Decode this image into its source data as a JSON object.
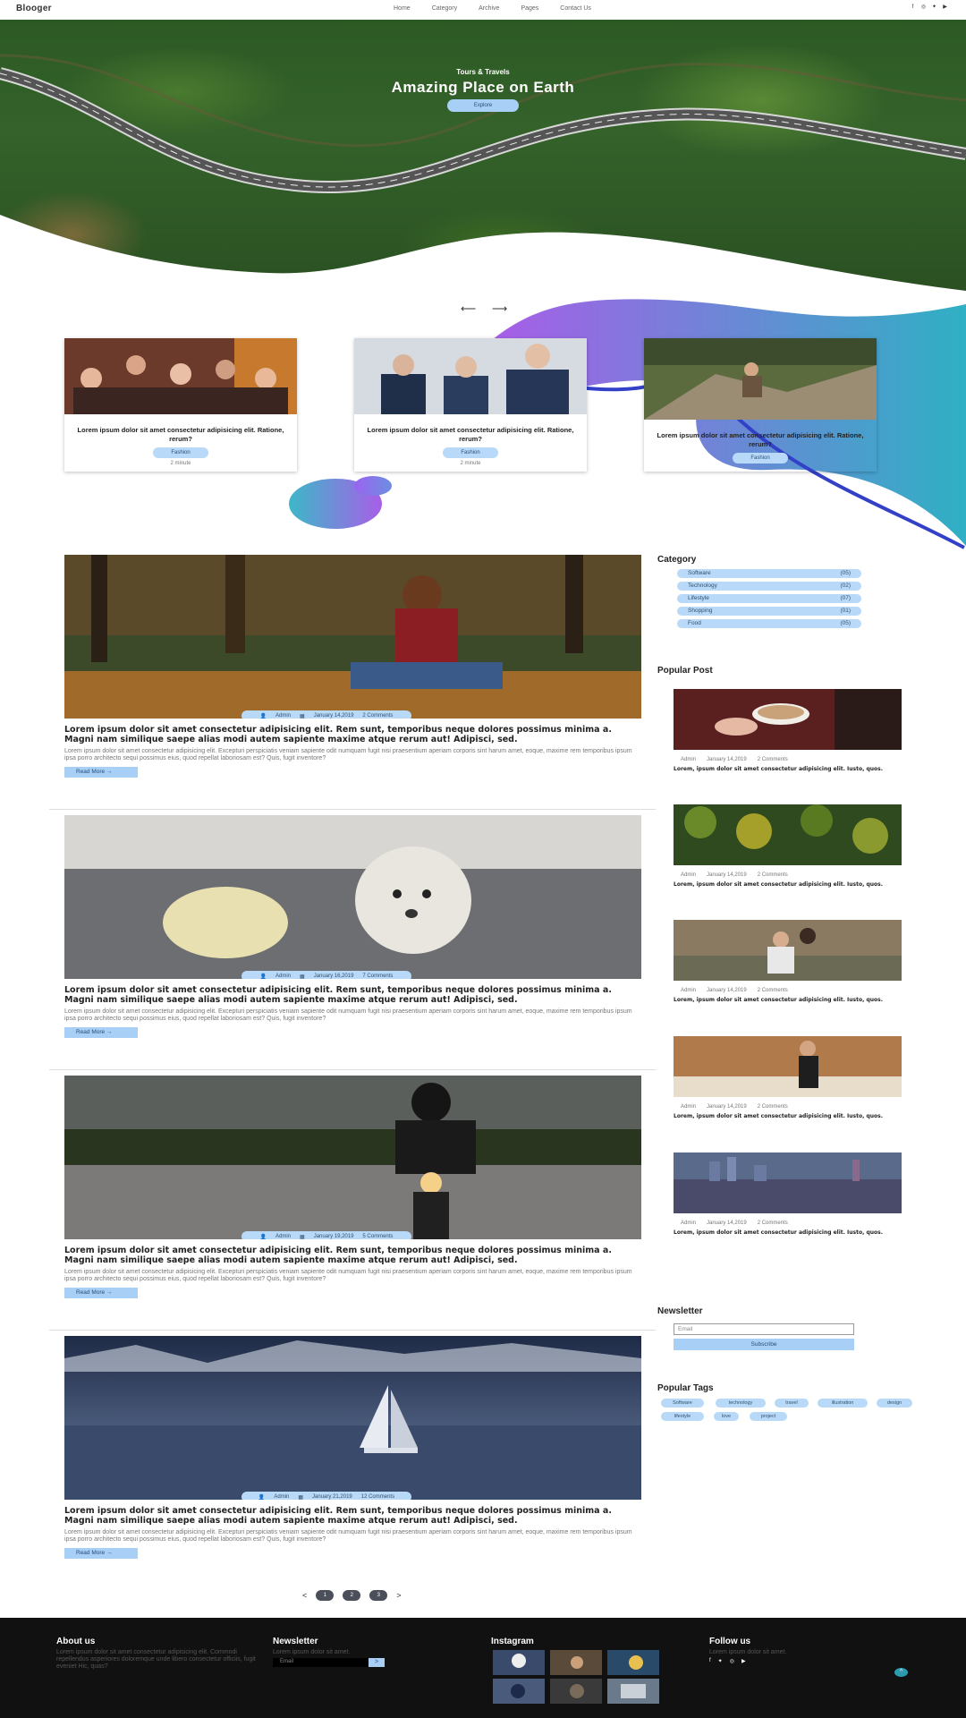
{
  "nav": {
    "brand": "Blooger",
    "menu": [
      "Home",
      "Category",
      "Archive",
      "Pages",
      "Contact Us"
    ],
    "social_icons": [
      "facebook-icon",
      "instagram-icon",
      "twitter-icon",
      "youtube-icon"
    ]
  },
  "hero": {
    "subtitle": "Tours & Travels",
    "title": "Amazing Place on Earth",
    "button": "Explore"
  },
  "carousel": {
    "prev_icon": "arrow-left-icon",
    "next_icon": "arrow-right-icon"
  },
  "featured": [
    {
      "title": "Lorem ipsum dolor sit amet consectetur adipisicing elit. Ratione, rerum?",
      "tag": "Fashion",
      "meta": "2 minute"
    },
    {
      "title": "Lorem ipsum dolor sit amet consectetur adipisicing elit. Ratione, rerum?",
      "tag": "Fashion",
      "meta": "2 minute"
    },
    {
      "title": "Lorem ipsum dolor sit amet consectetur adipisicing elit. Ratione, rerum?",
      "tag": "Fashion",
      "meta": ""
    }
  ],
  "posts": [
    {
      "author": "Admin",
      "date": "January 14,2019",
      "comments": "2 Comments",
      "title": "Lorem ipsum dolor sit amet consectetur adipisicing elit. Rem sunt, temporibus neque dolores possimus minima a. Magni nam similique saepe alias modi autem sapiente maxime atque rerum aut! Adipisci, sed.",
      "excerpt": "Lorem ipsum dolor sit amet consectetur adipisicing elit. Excepturi perspiciatis veniam sapiente odit numquam fugit nisi praesentium aperiam corporis sint harum amet, eoque, maxime rem temporibus ipsum ipsa porro architecto sequi possimus eius, quod repellat laboriosam est? Quis, fugit inventore?",
      "read_more": "Read More"
    },
    {
      "author": "Admin",
      "date": "January 16,2019",
      "comments": "7 Comments",
      "title": "Lorem ipsum dolor sit amet consectetur adipisicing elit. Rem sunt, temporibus neque dolores possimus minima a. Magni nam similique saepe alias modi autem sapiente maxime atque rerum aut! Adipisci, sed.",
      "excerpt": "Lorem ipsum dolor sit amet consectetur adipisicing elit. Excepturi perspiciatis veniam sapiente odit numquam fugit nisi praesentium aperiam corporis sint harum amet, eoque, maxime rem temporibus ipsum ipsa porro architecto sequi possimus eius, quod repellat laboriosam est? Quis, fugit inventore?",
      "read_more": "Read More"
    },
    {
      "author": "Admin",
      "date": "January 19,2019",
      "comments": "5 Comments",
      "title": "Lorem ipsum dolor sit amet consectetur adipisicing elit. Rem sunt, temporibus neque dolores possimus minima a. Magni nam similique saepe alias modi autem sapiente maxime atque rerum aut! Adipisci, sed.",
      "excerpt": "Lorem ipsum dolor sit amet consectetur adipisicing elit. Excepturi perspiciatis veniam sapiente odit numquam fugit nisi praesentium aperiam corporis sint harum amet, eoque, maxime rem temporibus ipsum ipsa porro architecto sequi possimus eius, quod repellat laboriosam est? Quis, fugit inventore?",
      "read_more": "Read More"
    },
    {
      "author": "Admin",
      "date": "January 21,2019",
      "comments": "12 Comments",
      "title": "Lorem ipsum dolor sit amet consectetur adipisicing elit. Rem sunt, temporibus neque dolores possimus minima a. Magni nam similique saepe alias modi autem sapiente maxime atque rerum aut! Adipisci, sed.",
      "excerpt": "Lorem ipsum dolor sit amet consectetur adipisicing elit. Excepturi perspiciatis veniam sapiente odit numquam fugit nisi praesentium aperiam corporis sint harum amet, eoque, maxime rem temporibus ipsum ipsa porro architecto sequi possimus eius, quod repellat laboriosam est? Quis, fugit inventore?",
      "read_more": "Read More"
    }
  ],
  "pagination": {
    "prev": "<",
    "pages": [
      "1",
      "2",
      "3"
    ],
    "next": ">"
  },
  "sidebar": {
    "category_title": "Category",
    "categories": [
      {
        "name": "Software",
        "count": "(05)"
      },
      {
        "name": "Technology",
        "count": "(02)"
      },
      {
        "name": "Lifestyle",
        "count": "(07)"
      },
      {
        "name": "Shopping",
        "count": "(01)"
      },
      {
        "name": "Food",
        "count": "(05)"
      }
    ],
    "popular_title": "Popular Post",
    "popular": [
      {
        "author": "Admin",
        "date": "January 14,2019",
        "comments": "2 Comments",
        "title": "Lorem, ipsum dolor sit amet consectetur adipisicing elit. Iusto, quos."
      },
      {
        "author": "Admin",
        "date": "January 14,2019",
        "comments": "2 Comments",
        "title": "Lorem, ipsum dolor sit amet consectetur adipisicing elit. Iusto, quos."
      },
      {
        "author": "Admin",
        "date": "January 14,2019",
        "comments": "2 Comments",
        "title": "Lorem, ipsum dolor sit amet consectetur adipisicing elit. Iusto, quos."
      },
      {
        "author": "Admin",
        "date": "January 14,2019",
        "comments": "2 Comments",
        "title": "Lorem, ipsum dolor sit amet consectetur adipisicing elit. Iusto, quos."
      },
      {
        "author": "Admin",
        "date": "January 14,2019",
        "comments": "2 Comments",
        "title": "Lorem, ipsum dolor sit amet consectetur adipisicing elit. Iusto, quos."
      }
    ],
    "newsletter_title": "Newsletter",
    "newsletter_placeholder": "Email",
    "newsletter_button": "Subscribe",
    "tags_title": "Popular Tags",
    "tags": [
      "Software",
      "technology",
      "travel",
      "illustration",
      "design",
      "lifestyle",
      "love",
      "project"
    ]
  },
  "footer": {
    "about_title": "About us",
    "about_text": "Lorem ipsum dolor sit amet consectetur adipisicing elit. Commodi repellendus asperiores doloremque unde libero consectetur officiis, fugit eveniet Hic, quas?",
    "newsletter_title": "Newsletter",
    "newsletter_text": "Lorem ipsum dolor sit amet.",
    "newsletter_placeholder": "Email",
    "newsletter_button": ">",
    "instagram_title": "Instagram",
    "follow_title": "Follow us",
    "follow_text": "Lorem ipsum dolor sit amet.",
    "follow_icons": [
      "facebook-icon",
      "twitter-icon",
      "instagram-icon",
      "youtube-icon"
    ],
    "back_to_top": "^"
  },
  "colors": {
    "accent": "#a8cff5",
    "tag_bg": "#b8d9f7",
    "gradient_start": "#a85ee8",
    "gradient_end": "#3cb8c8",
    "footer_bg": "#111111"
  }
}
